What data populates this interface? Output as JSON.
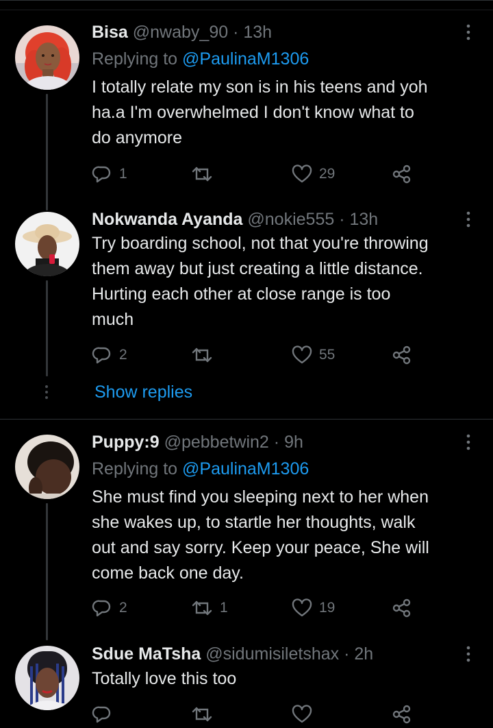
{
  "colors": {
    "background": "#000000",
    "text": "#e7e9ea",
    "secondary": "#71767b",
    "accent": "#1d9bf0",
    "divider": "#2f3336"
  },
  "tweets": [
    {
      "name": "Bisa",
      "handle": "@nwaby_90",
      "dot": "·",
      "time": "13h",
      "replying_prefix": "Replying to",
      "replying_to": "@PaulinaM1306",
      "lines": [
        "I totally relate my son is in his teens and yoh",
        "ha.a I'm overwhelmed I don't know what to",
        "do anymore"
      ],
      "replies": "1",
      "retweets": "",
      "likes": "29"
    },
    {
      "name": "Nokwanda Ayanda",
      "handle": "@nokie555",
      "dot": "·",
      "time": "13h",
      "lines": [
        "Try boarding school, not that you're throwing",
        "them away but just creating a little distance.",
        "Hurting each other at close range is too",
        "much"
      ],
      "replies": "2",
      "retweets": "",
      "likes": "55"
    },
    {
      "name": "Puppy:9",
      "handle": "@pebbetwin2",
      "dot": "·",
      "time": "9h",
      "replying_prefix": "Replying to",
      "replying_to": "@PaulinaM1306",
      "lines": [
        "She must find you sleeping next to her when",
        "she wakes up, to startle her thoughts, walk",
        "out and say sorry. Keep your peace, She will",
        "come back one day."
      ],
      "replies": "2",
      "retweets": "1",
      "likes": "19"
    },
    {
      "name": "Sdue MaTsha",
      "handle": "@sidumisiletshax",
      "dot": "·",
      "time": "2h",
      "lines": [
        "Totally love this too"
      ],
      "replies": "",
      "retweets": "",
      "likes": ""
    }
  ],
  "show_replies_label": "Show replies",
  "icons": {
    "reply": "reply-icon",
    "retweet": "retweet-icon",
    "like": "heart-icon",
    "share": "share-icon",
    "more": "more-icon"
  }
}
